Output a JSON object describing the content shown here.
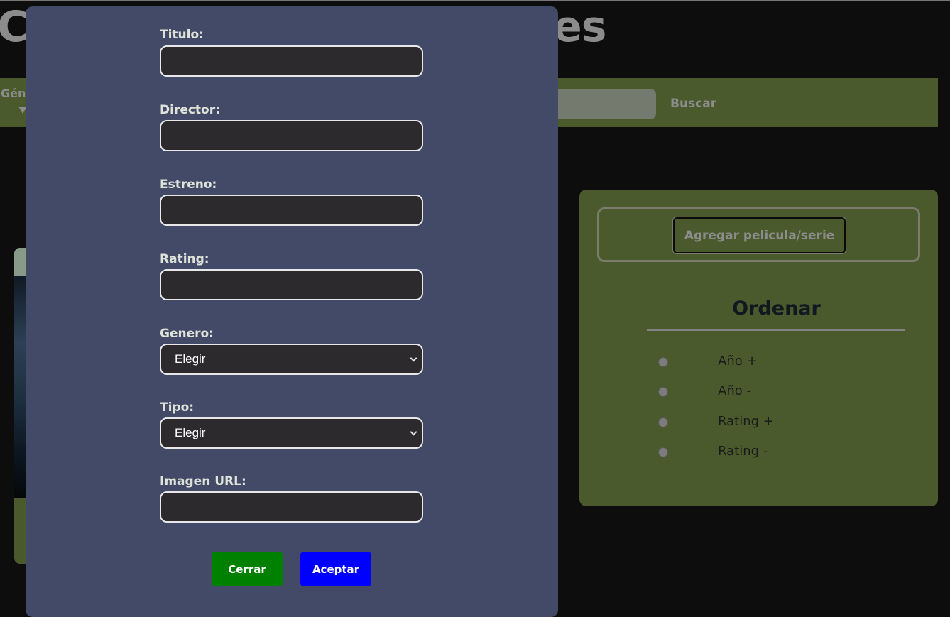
{
  "page": {
    "title_start": "C",
    "title_end": "es"
  },
  "nav": {
    "genre_label": "Gén",
    "search_value": "",
    "search_button": "Buscar"
  },
  "side_panel": {
    "add_button": "Agregar pelicula/serie",
    "sort_title": "Ordenar",
    "sort_options": [
      "Año +",
      "Año -",
      "Rating +",
      "Rating -"
    ]
  },
  "modal": {
    "fields": {
      "titulo": {
        "label": "Titulo:",
        "value": ""
      },
      "director": {
        "label": "Director:",
        "value": ""
      },
      "estreno": {
        "label": "Estreno:",
        "value": ""
      },
      "rating": {
        "label": "Rating:",
        "value": ""
      },
      "genero": {
        "label": "Genero:",
        "value": "Elegir"
      },
      "tipo": {
        "label": "Tipo:",
        "value": "Elegir"
      },
      "imagen": {
        "label": "Imagen URL:",
        "value": ""
      }
    },
    "buttons": {
      "close": "Cerrar",
      "accept": "Aceptar"
    }
  },
  "colors": {
    "modal_bg": "#424a68",
    "panel_bg": "#4b5a2c",
    "close_button": "#008000",
    "accept_button": "#0000ff"
  }
}
